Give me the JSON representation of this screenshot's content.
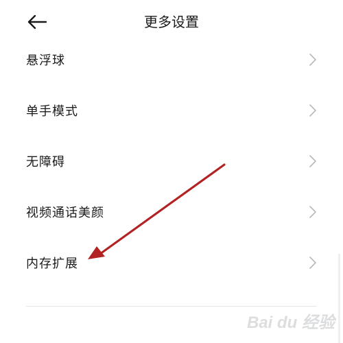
{
  "header": {
    "title": "更多设置",
    "back_icon": "arrow-left-icon"
  },
  "settings": {
    "items": [
      {
        "label": "悬浮球"
      },
      {
        "label": "单手模式"
      },
      {
        "label": "无障碍"
      },
      {
        "label": "视频通话美颜"
      },
      {
        "label": "内存扩展"
      }
    ],
    "chevron_icon": "chevron-right-icon"
  },
  "annotation": {
    "arrow_color": "#b22222"
  },
  "watermark": {
    "icon": "baidu-jingyan-logo",
    "text": "Bai du 经验"
  }
}
